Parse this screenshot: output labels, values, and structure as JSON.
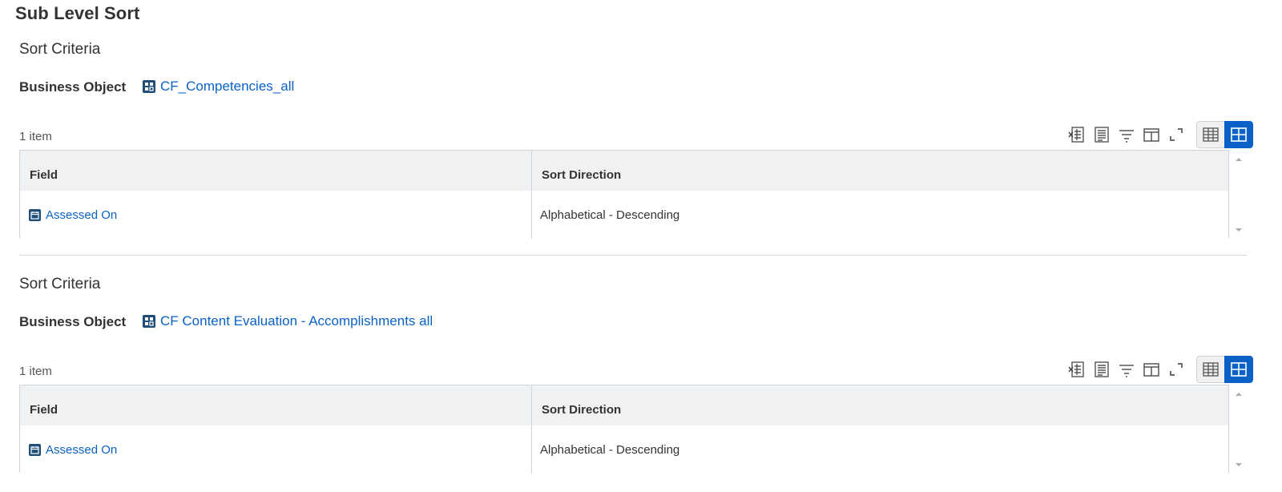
{
  "page": {
    "title": "Sub Level Sort"
  },
  "colors": {
    "link": "#0b62c6",
    "icon_bg": "#1f4e79",
    "header_bg": "#f0f1f3",
    "active_toggle": "#0b62c6"
  },
  "sections": [
    {
      "title": "Sort Criteria",
      "business_object_label": "Business Object",
      "business_object_value": "CF_Competencies_all",
      "business_object_icon": "business-object-icon",
      "item_count": "1 item",
      "toolbar_icons": [
        "export-excel-icon",
        "export-pdf-icon",
        "filter-icon",
        "columns-icon",
        "fullscreen-icon",
        "grid-view-icon",
        "table-view-icon"
      ],
      "columns": [
        "Field",
        "Sort Direction"
      ],
      "rows": [
        {
          "field": "Assessed On",
          "field_icon": "calendar-icon",
          "sort_direction": "Alphabetical - Descending"
        }
      ]
    },
    {
      "title": "Sort Criteria",
      "business_object_label": "Business Object",
      "business_object_value": "CF Content Evaluation - Accomplishments all",
      "business_object_icon": "business-object-icon",
      "item_count": "1 item",
      "toolbar_icons": [
        "export-excel-icon",
        "export-pdf-icon",
        "filter-icon",
        "columns-icon",
        "fullscreen-icon",
        "grid-view-icon",
        "table-view-icon"
      ],
      "columns": [
        "Field",
        "Sort Direction"
      ],
      "rows": [
        {
          "field": "Assessed On",
          "field_icon": "calendar-icon",
          "sort_direction": "Alphabetical - Descending"
        }
      ]
    }
  ]
}
